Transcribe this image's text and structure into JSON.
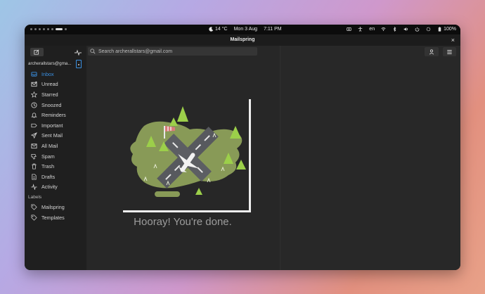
{
  "topbar": {
    "weather": "14 °C",
    "date": "Mon 3 Aug",
    "time": "7:11 PM",
    "language": "en",
    "battery": "100%"
  },
  "window": {
    "title": "Mailspring",
    "close_glyph": "×"
  },
  "sidebar": {
    "account": "archerallstars@gma...",
    "items": [
      {
        "label": "Inbox",
        "icon": "inbox-icon"
      },
      {
        "label": "Unread",
        "icon": "unread-icon"
      },
      {
        "label": "Starred",
        "icon": "star-icon"
      },
      {
        "label": "Snoozed",
        "icon": "clock-icon"
      },
      {
        "label": "Reminders",
        "icon": "bell-icon"
      },
      {
        "label": "Important",
        "icon": "important-tag-icon"
      },
      {
        "label": "Sent Mail",
        "icon": "send-icon"
      },
      {
        "label": "All Mail",
        "icon": "all-mail-icon"
      },
      {
        "label": "Spam",
        "icon": "thumbs-down-icon"
      },
      {
        "label": "Trash",
        "icon": "trash-icon"
      },
      {
        "label": "Drafts",
        "icon": "drafts-icon"
      },
      {
        "label": "Activity",
        "icon": "activity-icon"
      }
    ],
    "labels_title": "Labels",
    "labels": [
      {
        "label": "Mailspring",
        "icon": "label-tag-icon"
      },
      {
        "label": "Templates",
        "icon": "label-tag-icon"
      }
    ]
  },
  "search": {
    "placeholder": "Search archerallstars@gmail.com"
  },
  "empty_state": {
    "message": "Hooray! You're done."
  },
  "colors": {
    "accent": "#3a8fe0",
    "sidebar_bg": "#1f1f1f",
    "content_bg": "#272727"
  }
}
